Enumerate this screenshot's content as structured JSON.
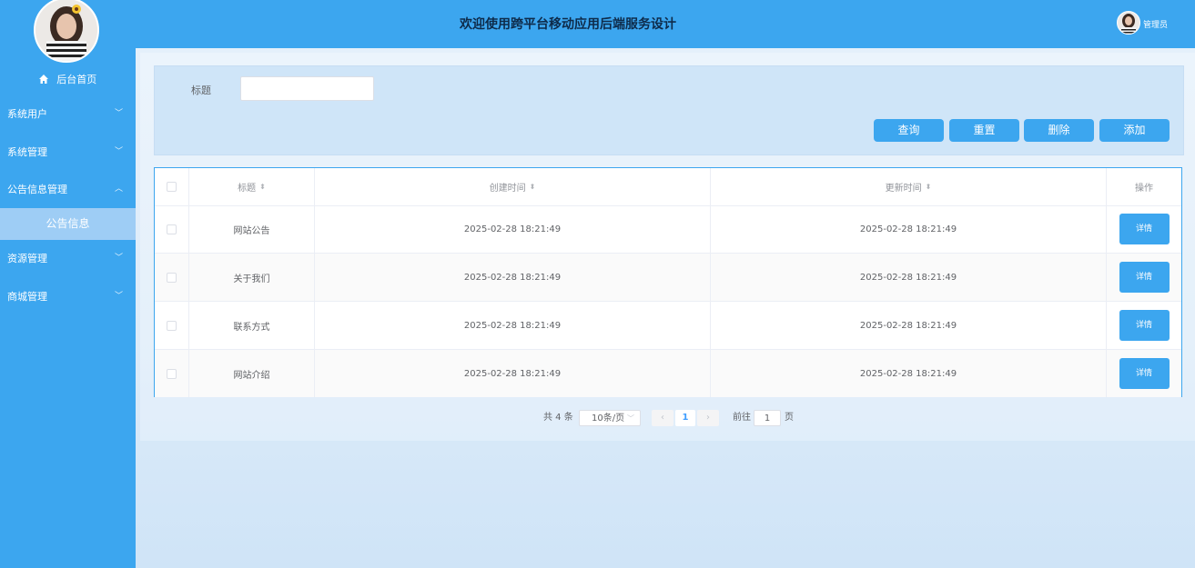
{
  "header": {
    "title": "欢迎使用跨平台移动应用后端服务设计",
    "role": "管理员"
  },
  "sidebar": {
    "home_label": "后台首页",
    "menus": [
      {
        "label": "系统用户"
      },
      {
        "label": "系统管理"
      },
      {
        "label": "公告信息管理",
        "expanded": true
      },
      {
        "label": "资源管理"
      },
      {
        "label": "商城管理"
      }
    ],
    "active_sub": "公告信息"
  },
  "search": {
    "field_label": "标题",
    "field_value": "",
    "buttons": {
      "query": "查询",
      "reset": "重置",
      "delete": "删除",
      "add": "添加"
    }
  },
  "table": {
    "columns": [
      "标题",
      "创建时间",
      "更新时间",
      "操作"
    ],
    "rows": [
      {
        "title": "网站公告",
        "created": "2025-02-28 18:21:49",
        "updated": "2025-02-28 18:21:49",
        "action": "详情"
      },
      {
        "title": "关于我们",
        "created": "2025-02-28 18:21:49",
        "updated": "2025-02-28 18:21:49",
        "action": "详情"
      },
      {
        "title": "联系方式",
        "created": "2025-02-28 18:21:49",
        "updated": "2025-02-28 18:21:49",
        "action": "详情"
      },
      {
        "title": "网站介绍",
        "created": "2025-02-28 18:21:49",
        "updated": "2025-02-28 18:21:49",
        "action": "详情"
      }
    ]
  },
  "pagination": {
    "total_text": "共 4 条",
    "page_size": "10条/页",
    "current_page": "1",
    "goto_label": "前往",
    "goto_value": "1",
    "page_suffix": "页"
  },
  "colors": {
    "primary": "#3ca6ef",
    "active_sub": "#9ecdf5",
    "title_text": "#0e2b4a"
  },
  "icons": {
    "home": "home-icon",
    "expand": "chevron-down-icon",
    "collapse": "chevron-up-icon",
    "sort": "sort-caret-icon",
    "prev": "chevron-left-icon",
    "next": "chevron-right-icon"
  }
}
